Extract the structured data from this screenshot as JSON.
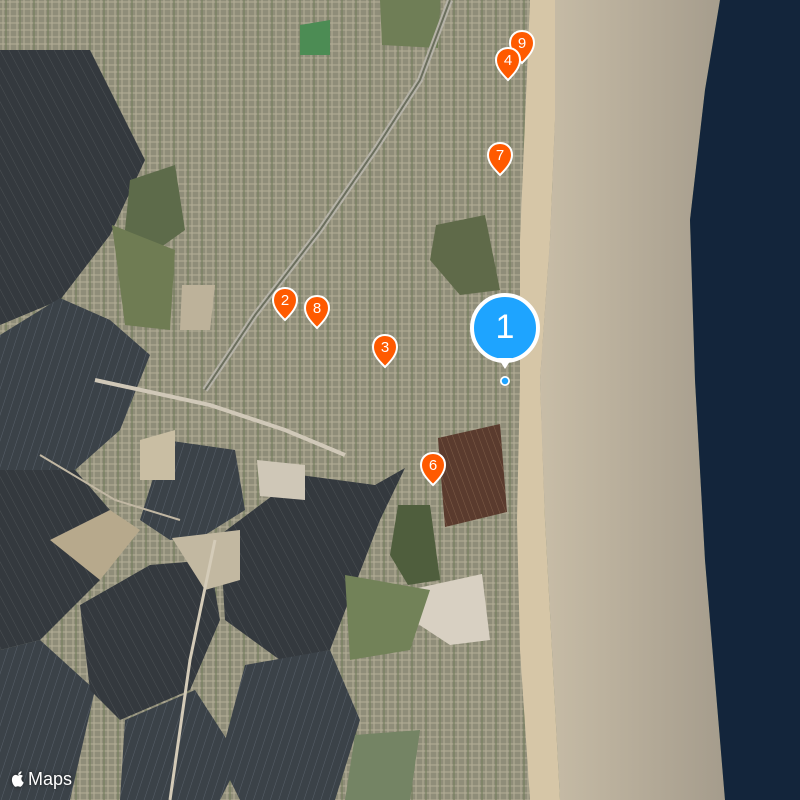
{
  "map": {
    "type": "satellite",
    "attribution": "Maps",
    "attribution_icon": "apple-logo-icon",
    "colors": {
      "sea": "#b7ab96",
      "deep_water": "#13253b",
      "beach": "#d8c7a8",
      "fields": "#30373b",
      "pin": "#ff5a00",
      "current_location": "#1ea4ff"
    }
  },
  "current_location": {
    "label": "1"
  },
  "markers": [
    {
      "label": "9"
    },
    {
      "label": "4"
    },
    {
      "label": "7"
    },
    {
      "label": "2"
    },
    {
      "label": "8"
    },
    {
      "label": "3"
    },
    {
      "label": "6"
    }
  ]
}
